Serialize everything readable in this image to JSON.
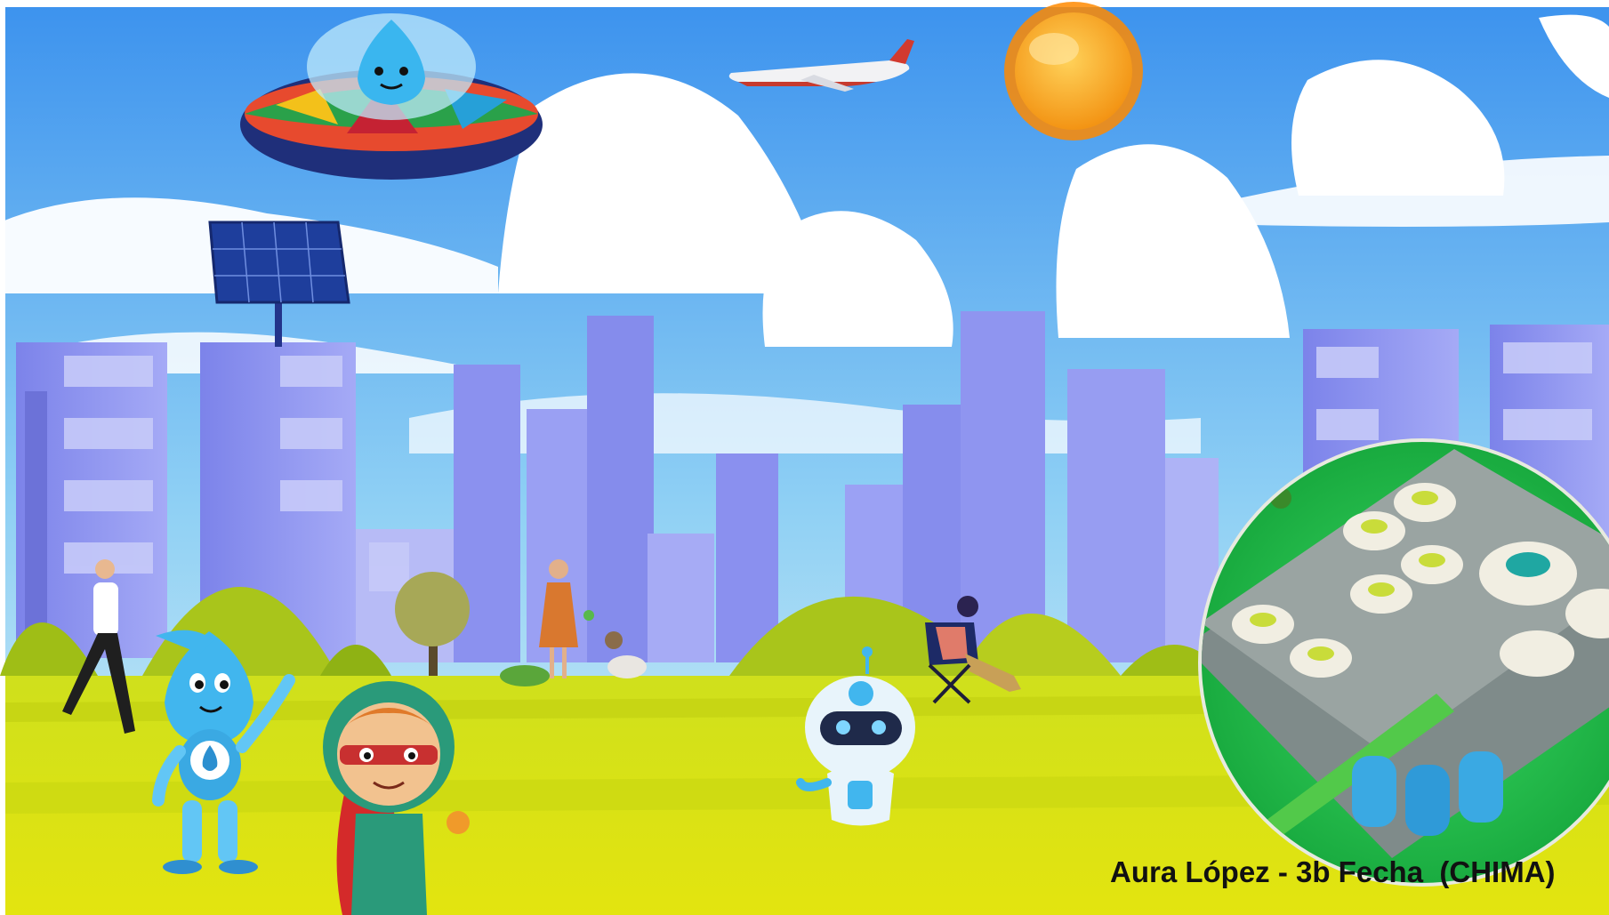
{
  "caption": {
    "text": "Aura López - 3b Fecha  (CHIMA)"
  },
  "colors": {
    "sky_top": "#4a9ff0",
    "sky_bottom": "#bfe6f5",
    "building": "#8f96f2",
    "grass": "#d8de18",
    "hill": "#a8c41a",
    "sun": "#f6a017",
    "droplet": "#47b8ef",
    "circle_green": "#21c24f"
  },
  "icons": [
    "ufo-icon",
    "airplane-icon",
    "sun-icon",
    "solar-panel-icon",
    "water-drop-mascot-icon",
    "superhero-kid-icon",
    "robot-mascot-icon",
    "water-filter-device-icon"
  ]
}
